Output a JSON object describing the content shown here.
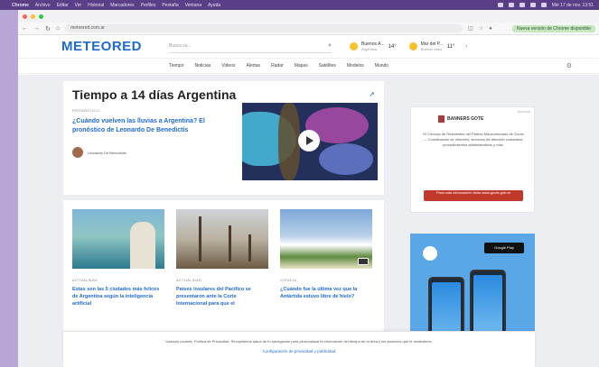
{
  "menubar": {
    "app": "Chrome",
    "items": [
      "Archivo",
      "Editar",
      "Ver",
      "Historial",
      "Marcadores",
      "Perfiles",
      "Pestaña",
      "Ventana",
      "Ayuda"
    ],
    "clock": "Mié 17 de nov. 13:51"
  },
  "browser": {
    "url": "meteored.com.ar",
    "update_label": "Nueva versión de Chrome disponible"
  },
  "site": {
    "logo": "METEORED",
    "search_placeholder": "Busca su...",
    "weather": [
      {
        "city": "Buenos A...",
        "region": "Argentina",
        "temp": "14°"
      },
      {
        "city": "Mar del P...",
        "region": "Buenos Aires",
        "temp": "11°"
      }
    ],
    "nav": [
      "Tiempo",
      "Noticias",
      "Videos",
      "Alertas",
      "Radar",
      "Mapas",
      "Satélites",
      "Modelos",
      "Mundo"
    ]
  },
  "feature": {
    "title": "Tiempo a 14 días Argentina",
    "tag": "PRONÓSTICO",
    "headline": "¿Cuándo vuelven las lluvias a Argentina? El pronóstico de Leonardo De Benedictis",
    "author": "Leonardo De Benedictis"
  },
  "cards": [
    {
      "tag": "ACTUALIDAD",
      "title": "Estas son las 5 ciudades más felices de Argentina según la inteligencia artificial"
    },
    {
      "tag": "ACTUALIDAD",
      "title": "Países insulares del Pacífico se presentaron ante la Corte Internacional para que el"
    },
    {
      "tag": "CIENCIA",
      "title": "¿Cuándo fue la última vez que la Antártida estuvo libre de hielo?"
    }
  ],
  "ads": {
    "ad_label": "Anuncio",
    "ad1_title": "BANNERS GOTE",
    "ad1_body": "El Concejo de Residentes del Partido Mancomunado de Gouts — Coordinación de informes, servicios de atención ciudadana, procedimientos administrativos y más.",
    "ad1_cta": "Para más información visita www.gouts.gob.ar",
    "ad2_store": "Google Play"
  },
  "cookie": {
    "text": "Usamos cookies. Política de Privacidad. Recopilamos datos de tu navegación para personalizar la información del tiempo en tu área y los anuncios que te mostramos.",
    "config": "Configuración de privacidad y publicidad"
  }
}
